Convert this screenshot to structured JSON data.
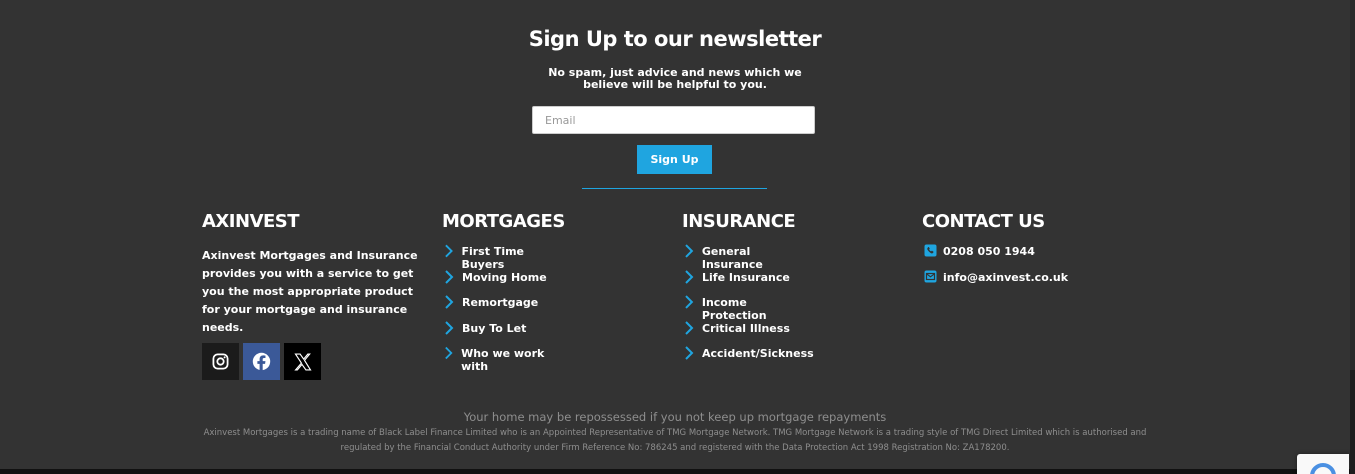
{
  "newsletter": {
    "title": "Sign Up to our newsletter",
    "subtitle": "No spam, just advice and news which we believe will be helpful to you.",
    "email_placeholder": "Email",
    "button_label": "Sign Up"
  },
  "about": {
    "heading": "AXINVEST",
    "text": "Axinvest Mortgages and Insurance provides you with a service to get you the most appropriate product for your mortgage and insurance needs.",
    "social": [
      "instagram-icon",
      "facebook-icon",
      "x-icon"
    ]
  },
  "mortgages": {
    "heading": "MORTGAGES",
    "items": [
      "First Time Buyers",
      "Moving Home",
      "Remortgage",
      "Buy To Let",
      "Who we work with"
    ]
  },
  "insurance": {
    "heading": "INSURANCE",
    "items": [
      "General Insurance",
      "Life Insurance",
      "Income Protection",
      "Critical Illness",
      "Accident/Sickness"
    ]
  },
  "contact": {
    "heading": "CONTACT US",
    "phone": "0208 050 1944",
    "email": "info@axinvest.co.uk"
  },
  "disclaimer": {
    "line1": "Your home may be repossessed if you not keep up mortgage repayments",
    "line2": "Axinvest Mortgages is a trading name of Black Label Finance Limited who is an Appointed Representative of TMG Mortgage Network. TMG Mortgage Network is a trading style of TMG Direct Limited which is authorised and regulated by the Financial Conduct Authority under Firm Reference No: 786245 and registered with the Data Protection Act 1998 Registration No: ZA178200."
  },
  "colors": {
    "background": "#333333",
    "accent": "#1fa5e0",
    "facebook": "#3b5998"
  }
}
